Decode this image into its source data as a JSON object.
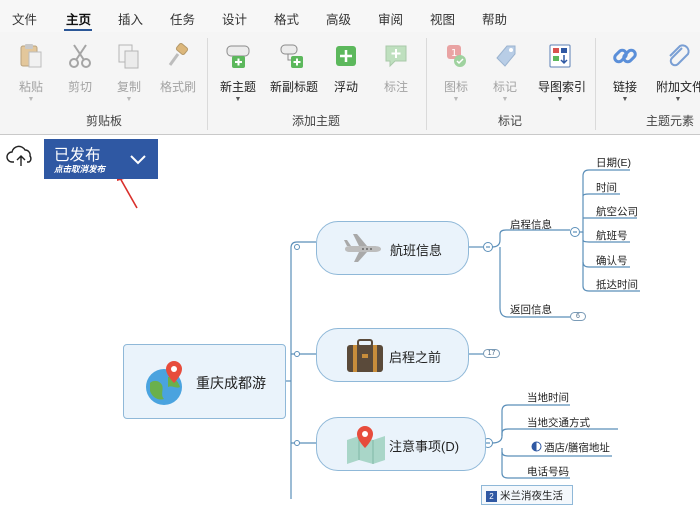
{
  "menu": {
    "items": [
      "文件",
      "主页",
      "插入",
      "任务",
      "设计",
      "格式",
      "高级",
      "审阅",
      "视图",
      "帮助"
    ],
    "active_index": 1
  },
  "ribbon": {
    "clipboard": {
      "paste": "粘贴",
      "cut": "剪切",
      "copy": "复制",
      "format_painter": "格式刷",
      "group_label": "剪贴板"
    },
    "add_topic": {
      "new_topic": "新主题",
      "new_subtopic": "新副标题",
      "floating": "浮动",
      "callout": "标注",
      "group_label": "添加主题"
    },
    "markers": {
      "icon": "图标",
      "tag": "标记",
      "map_index": "导图索引",
      "group_label": "标记"
    },
    "topic_elements": {
      "link": "链接",
      "attachment": "附加文件",
      "group_label": "主题元素"
    }
  },
  "publish": {
    "status": "已发布",
    "hint": "点击取消发布"
  },
  "mindmap": {
    "root": "重庆成都游",
    "flight": {
      "title": "航班信息",
      "departure": "启程信息",
      "departure_items": [
        "日期(E)",
        "时间",
        "航空公司",
        "航班号",
        "确认号",
        "抵达时间"
      ],
      "return": "返回信息",
      "return_badge": "6"
    },
    "before": {
      "title": "启程之前",
      "badge": "17"
    },
    "notes": {
      "title": "注意事项(D)",
      "items": [
        "当地时间",
        "当地交通方式",
        "酒店/膳宿地址",
        "电话号码"
      ]
    },
    "partial_node": {
      "num": "2",
      "text": "米兰消夜生活"
    }
  },
  "colors": {
    "accent_blue": "#2f58a3",
    "node_border": "#8fb8d8",
    "node_fill": "#eaf3fb",
    "branch_line": "#5b8fb9",
    "arrow_red": "#d9302c"
  }
}
